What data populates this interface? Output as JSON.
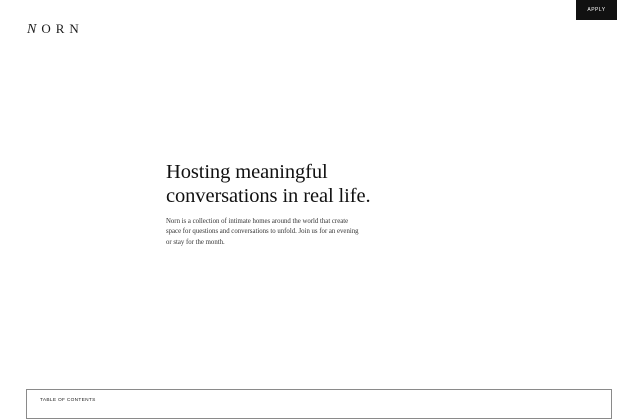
{
  "header": {
    "logo_first": "N",
    "logo_rest": "ORN",
    "apply_label": "APPLY"
  },
  "hero": {
    "title_line1": "Hosting meaningful",
    "title_line2": "conversations in real life.",
    "description": "Norn is a collection of intimate homes around the world that create space for questions and conversations to unfold. Join us for an evening or stay for the month."
  },
  "toc": {
    "label": "TABLE OF CONTENTS"
  }
}
